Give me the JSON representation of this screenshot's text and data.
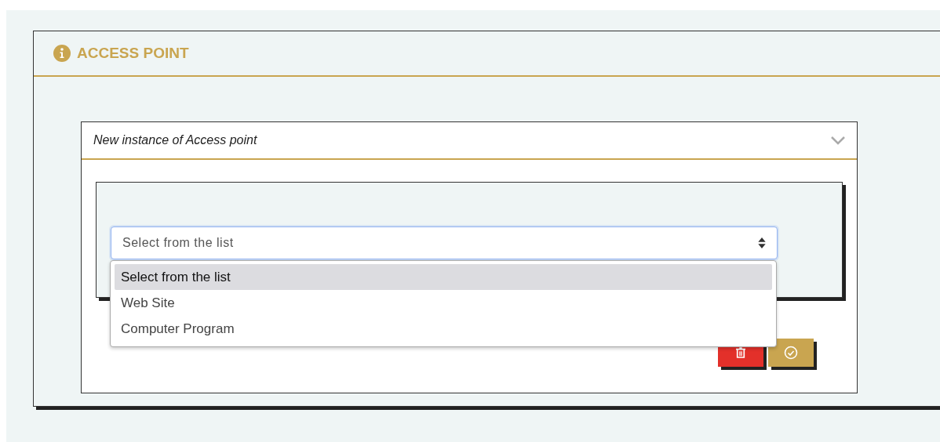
{
  "section": {
    "title": "ACCESS POINT"
  },
  "panel": {
    "title": "New instance of Access point",
    "expanded": true
  },
  "select": {
    "placeholder": "Select from the list",
    "open": true,
    "options": [
      {
        "label": "Select from the list",
        "selected": true
      },
      {
        "label": "Web Site",
        "selected": false
      },
      {
        "label": "Computer Program",
        "selected": false
      }
    ]
  }
}
